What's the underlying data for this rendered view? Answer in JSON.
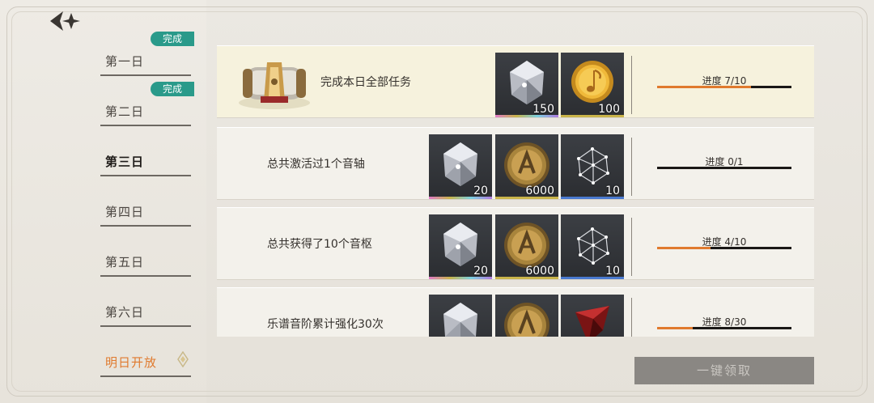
{
  "days": [
    {
      "label": "第一日",
      "badge": "完成"
    },
    {
      "label": "第二日",
      "badge": "完成"
    },
    {
      "label": "第三日"
    },
    {
      "label": "第四日"
    },
    {
      "label": "第五日"
    },
    {
      "label": "第六日"
    },
    {
      "label": "明日开放"
    }
  ],
  "active_day": "第三日",
  "tasks": [
    {
      "text": "完成本日全部任务",
      "rewards": [
        {
          "icon": "crystal-icon",
          "qty": "150"
        },
        {
          "icon": "gold-note-coin-icon",
          "qty": "100"
        }
      ],
      "progress_text": "进度 7/10",
      "progress": 0.7
    },
    {
      "text": "总共激活过1个音轴",
      "rewards": [
        {
          "icon": "crystal-icon",
          "qty": "20"
        },
        {
          "icon": "bronze-coin-icon",
          "qty": "6000"
        },
        {
          "icon": "crystal-lattice-icon",
          "qty": "10"
        }
      ],
      "progress_text": "进度 0/1",
      "progress": 0
    },
    {
      "text": "总共获得了10个音枢",
      "rewards": [
        {
          "icon": "crystal-icon",
          "qty": "20"
        },
        {
          "icon": "bronze-coin-icon",
          "qty": "6000"
        },
        {
          "icon": "crystal-lattice-icon",
          "qty": "10"
        }
      ],
      "progress_text": "进度 4/10",
      "progress": 0.4
    },
    {
      "text": "乐谱音阶累计强化30次",
      "rewards": [
        {
          "icon": "crystal-icon",
          "qty": ""
        },
        {
          "icon": "bronze-coin-icon",
          "qty": ""
        },
        {
          "icon": "red-gem-icon",
          "qty": ""
        }
      ],
      "progress_text": "进度 8/30",
      "progress": 0.2667
    }
  ],
  "claim_all_label": "一键领取",
  "colors": {
    "accent": "#e07a2e",
    "badge": "#2a9a8a"
  }
}
